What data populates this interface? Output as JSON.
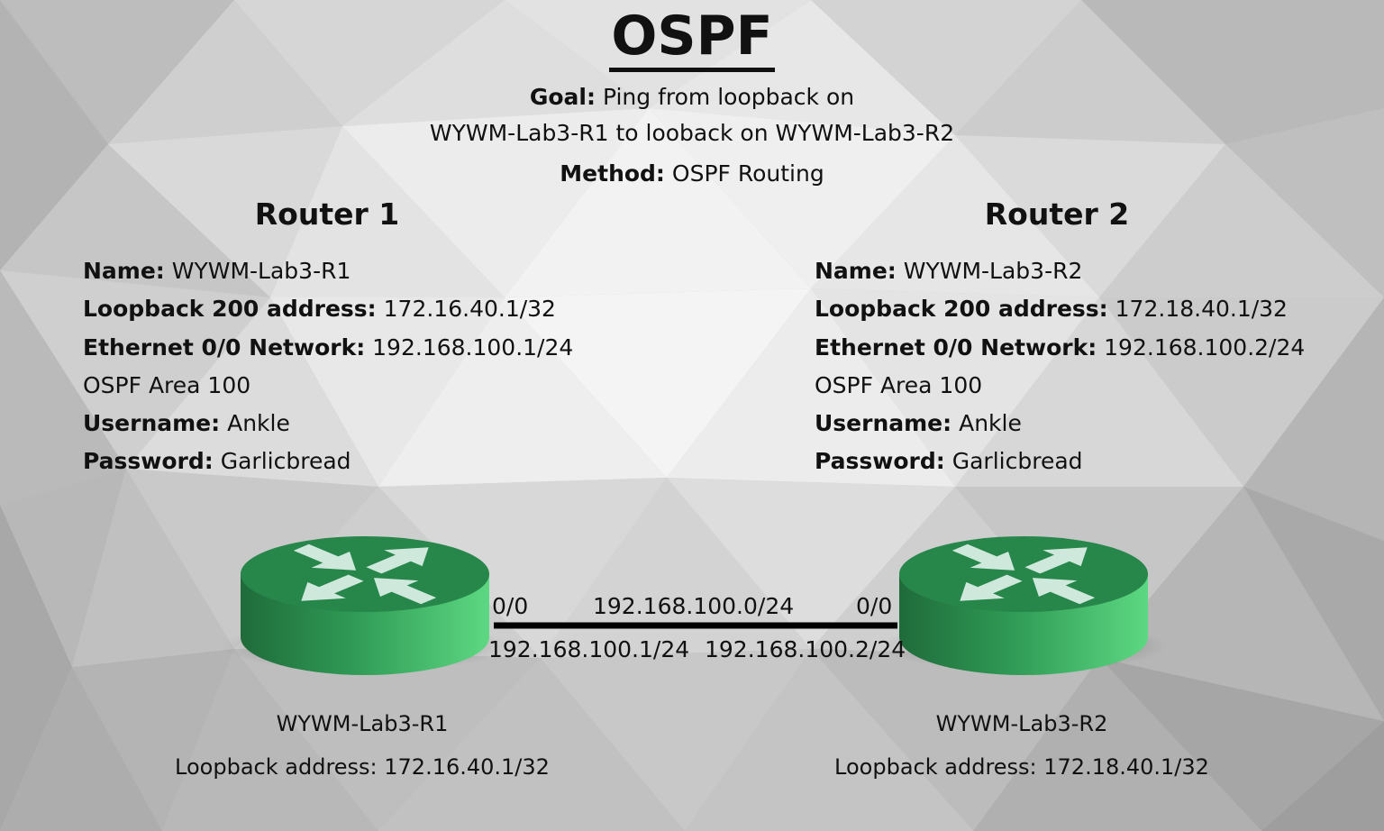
{
  "title": "OSPF",
  "goal": {
    "label": "Goal:",
    "text_line1": "Ping from loopback on",
    "text_line2": "WYWM-Lab3-R1 to looback on WYWM-Lab3-R2"
  },
  "method": {
    "label": "Method:",
    "text": "OSPF Routing"
  },
  "routers": [
    {
      "heading": "Router 1",
      "name_label": "Name:",
      "name": "WYWM-Lab3-R1",
      "loopback_label": "Loopback 200 address:",
      "loopback": "172.16.40.1/32",
      "ethernet_label": "Ethernet 0/0 Network:",
      "ethernet": "192.168.100.1/24",
      "ospf_area": "OSPF Area 100",
      "username_label": "Username:",
      "username": "Ankle",
      "password_label": "Password:",
      "password": "Garlicbread",
      "caption_name": "WYWM-Lab3-R1",
      "caption_loopback": "Loopback address: 172.16.40.1/32",
      "interface": "0/0",
      "interface_ip": "192.168.100.1/24"
    },
    {
      "heading": "Router 2",
      "name_label": "Name:",
      "name": "WYWM-Lab3-R2",
      "loopback_label": "Loopback 200 address:",
      "loopback": "172.18.40.1/32",
      "ethernet_label": "Ethernet 0/0 Network:",
      "ethernet": "192.168.100.2/24",
      "ospf_area": "OSPF Area 100",
      "username_label": "Username:",
      "username": "Ankle",
      "password_label": "Password:",
      "password": "Garlicbread",
      "caption_name": "WYWM-Lab3-R2",
      "caption_loopback": "Loopback address: 172.18.40.1/32",
      "interface": "0/0",
      "interface_ip": "192.168.100.2/24"
    }
  ],
  "link": {
    "network": "192.168.100.0/24"
  },
  "colors": {
    "router_top": "#27864a",
    "router_side_light": "#5dd882",
    "router_side_dark": "#1f6b3a",
    "arrow": "#cfe8dc",
    "link_line": "#000000"
  }
}
